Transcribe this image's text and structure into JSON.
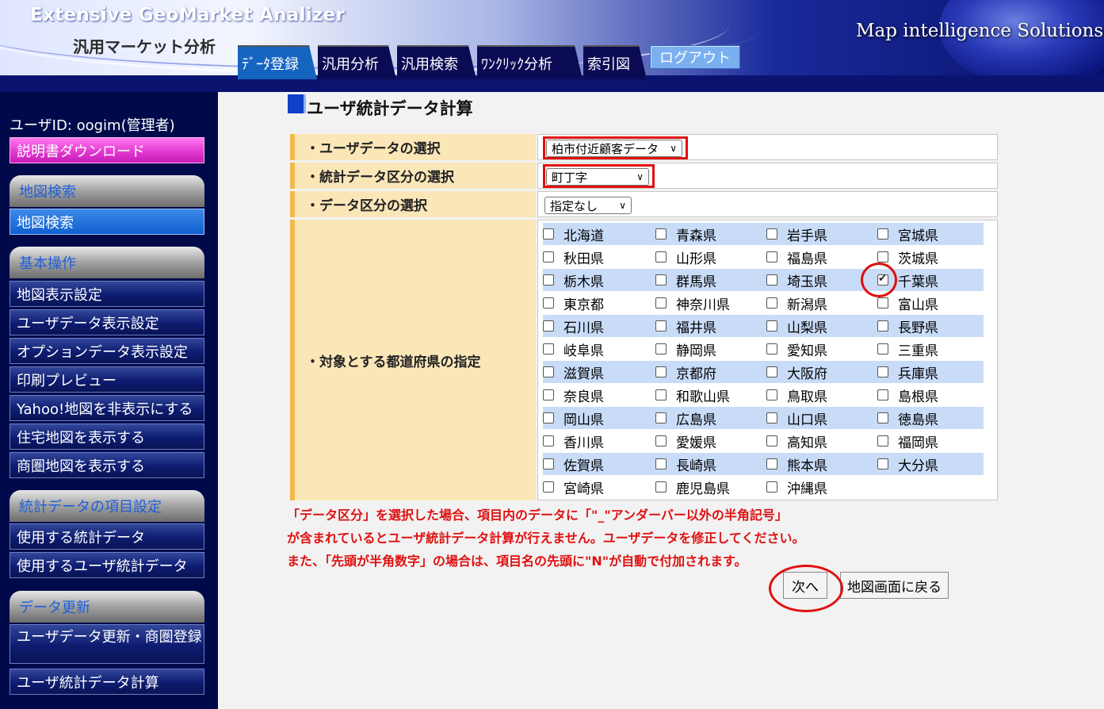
{
  "header": {
    "app_title": "Extensive GeoMarket Analizer",
    "app_subtitle": "汎用マーケット分析",
    "brand": "Map intelligence Solutions",
    "tabs": [
      {
        "label": "ﾃﾞｰﾀ登録",
        "active": true
      },
      {
        "label": "汎用分析",
        "active": false
      },
      {
        "label": "汎用検索",
        "active": false
      },
      {
        "label": "ﾜﾝｸﾘｯｸ分析",
        "active": false
      },
      {
        "label": "索引図",
        "active": false
      }
    ],
    "logout_label": "ログアウト"
  },
  "sidebar": {
    "user_id": "ユーザID: oogim(管理者)",
    "manual_download": "説明書ダウンロード",
    "sections": [
      {
        "title": "地図検索",
        "items": [
          "地図検索"
        ]
      },
      {
        "title": "基本操作",
        "items": [
          "地図表示設定",
          "ユーザデータ表示設定",
          "オプションデータ表示設定",
          "印刷プレビュー",
          "Yahoo!地図を非表示にする",
          "住宅地図を表示する",
          "商圏地図を表示する"
        ]
      },
      {
        "title": "統計データの項目設定",
        "items": [
          "使用する統計データ",
          "使用するユーザ統計データ"
        ]
      },
      {
        "title": "データ更新",
        "items": [
          "ユーザデータ更新・商圏登録",
          "ユーザ統計データ計算"
        ]
      }
    ]
  },
  "main": {
    "page_title": "ユーザ統計データ計算",
    "form": {
      "user_data_label": "・ユーザデータの選択",
      "user_data_value": "柏市付近顧客データ",
      "stat_division_label": "・統計データ区分の選択",
      "stat_division_value": "町丁字",
      "data_division_label": "・データ区分の選択",
      "data_division_value": "指定なし",
      "prefecture_label": "・対象とする都道府県の指定"
    },
    "prefectures": [
      {
        "name": "北海道",
        "checked": false
      },
      {
        "name": "青森県",
        "checked": false
      },
      {
        "name": "岩手県",
        "checked": false
      },
      {
        "name": "宮城県",
        "checked": false
      },
      {
        "name": "秋田県",
        "checked": false
      },
      {
        "name": "山形県",
        "checked": false
      },
      {
        "name": "福島県",
        "checked": false
      },
      {
        "name": "茨城県",
        "checked": false
      },
      {
        "name": "栃木県",
        "checked": false
      },
      {
        "name": "群馬県",
        "checked": false
      },
      {
        "name": "埼玉県",
        "checked": false
      },
      {
        "name": "千葉県",
        "checked": true
      },
      {
        "name": "東京都",
        "checked": false
      },
      {
        "name": "神奈川県",
        "checked": false
      },
      {
        "name": "新潟県",
        "checked": false
      },
      {
        "name": "富山県",
        "checked": false
      },
      {
        "name": "石川県",
        "checked": false
      },
      {
        "name": "福井県",
        "checked": false
      },
      {
        "name": "山梨県",
        "checked": false
      },
      {
        "name": "長野県",
        "checked": false
      },
      {
        "name": "岐阜県",
        "checked": false
      },
      {
        "name": "静岡県",
        "checked": false
      },
      {
        "name": "愛知県",
        "checked": false
      },
      {
        "name": "三重県",
        "checked": false
      },
      {
        "name": "滋賀県",
        "checked": false
      },
      {
        "name": "京都府",
        "checked": false
      },
      {
        "name": "大阪府",
        "checked": false
      },
      {
        "name": "兵庫県",
        "checked": false
      },
      {
        "name": "奈良県",
        "checked": false
      },
      {
        "name": "和歌山県",
        "checked": false
      },
      {
        "name": "鳥取県",
        "checked": false
      },
      {
        "name": "島根県",
        "checked": false
      },
      {
        "name": "岡山県",
        "checked": false
      },
      {
        "name": "広島県",
        "checked": false
      },
      {
        "name": "山口県",
        "checked": false
      },
      {
        "name": "徳島県",
        "checked": false
      },
      {
        "name": "香川県",
        "checked": false
      },
      {
        "name": "愛媛県",
        "checked": false
      },
      {
        "name": "高知県",
        "checked": false
      },
      {
        "name": "福岡県",
        "checked": false
      },
      {
        "name": "佐賀県",
        "checked": false
      },
      {
        "name": "長崎県",
        "checked": false
      },
      {
        "name": "熊本県",
        "checked": false
      },
      {
        "name": "大分県",
        "checked": false
      },
      {
        "name": "宮崎県",
        "checked": false
      },
      {
        "name": "鹿児島県",
        "checked": false
      },
      {
        "name": "沖縄県",
        "checked": false
      }
    ],
    "notice_lines": [
      "「データ区分」を選択した場合、項目内のデータに「\"_\"アンダーバー以外の半角記号」",
      "が含まれているとユーザ統計データ計算が行えません。ユーザデータを修正してください。",
      "また、「先頭が半角数字」の場合は、項目名の先頭に\"N\"が自動で付加されます。"
    ],
    "next_button": "次へ",
    "back_button": "地図画面に戻る"
  },
  "colors": {
    "accent_red": "#e01010",
    "label_bg": "#fbe6b8",
    "sidebar_bg": "#000a4a"
  }
}
